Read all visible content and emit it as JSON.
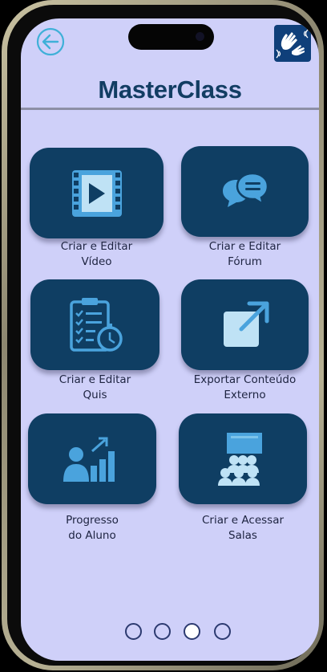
{
  "app": {
    "title": "MasterClass"
  },
  "header": {
    "back_icon": "back-arrow-icon",
    "accessibility_icon": "sign-language-icon"
  },
  "menu": {
    "items": [
      {
        "label": "Criar e Editar\nVídeo",
        "icon": "video-icon"
      },
      {
        "label": "Criar e Editar\nFórum",
        "icon": "chat-bubbles-icon"
      },
      {
        "label": "Criar e Editar\nQuis",
        "icon": "quiz-clipboard-icon"
      },
      {
        "label": "Exportar Conteúdo\nExterno",
        "icon": "external-link-icon"
      },
      {
        "label": "Progresso\ndo Aluno",
        "icon": "student-progress-icon"
      },
      {
        "label": "Criar e Acessar\nSalas",
        "icon": "classroom-icon"
      }
    ]
  },
  "pagination": {
    "total": 4,
    "active": 3
  },
  "colors": {
    "background": "#cfd0f9",
    "card": "#0f3e63",
    "icon": "#4aa3dd",
    "title": "#123d63"
  }
}
